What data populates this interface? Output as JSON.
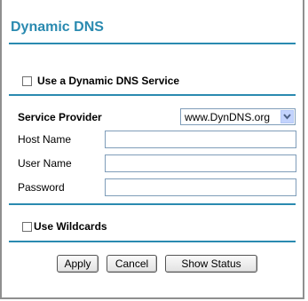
{
  "title": "Dynamic DNS",
  "use_dynamic_dns": {
    "label": "Use a Dynamic DNS Service",
    "checked": false
  },
  "service_provider": {
    "label": "Service Provider",
    "selected": "www.DynDNS.org"
  },
  "fields": {
    "host_name": {
      "label": "Host Name",
      "value": ""
    },
    "user_name": {
      "label": "User Name",
      "value": ""
    },
    "password": {
      "label": "Password",
      "value": ""
    }
  },
  "use_wildcards": {
    "label": "Use Wildcards",
    "checked": false
  },
  "buttons": {
    "apply": "Apply",
    "cancel": "Cancel",
    "show_status": "Show Status"
  },
  "colors": {
    "accent": "#2a8ab0"
  },
  "icons": {
    "dropdown": "chevron-down-icon"
  }
}
